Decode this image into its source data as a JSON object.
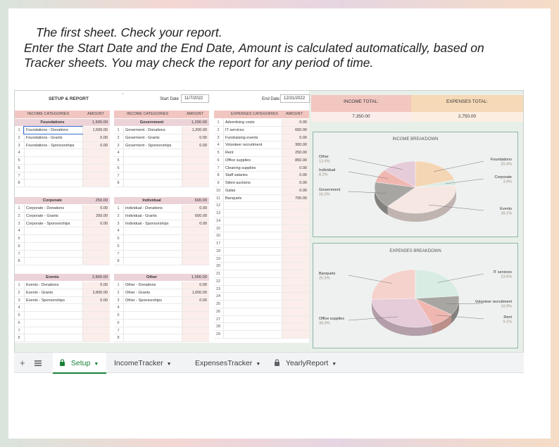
{
  "intro": {
    "line1": "The first sheet. Check your report.",
    "line2": "Enter the Start Date and the End Date, Amount is calculated automatically, based on",
    "line3": "Tracker sheets. You may check the report for any period of time."
  },
  "sheet": {
    "title": "SETUP & REPORT",
    "start_label": "Start Date",
    "start_value": "11/7/2022",
    "end_label": "End Date",
    "end_value": "12/31/2022",
    "income_header": {
      "cat": "INCOME CATEGORIES",
      "amt": "AMOUNT"
    },
    "expenses_header": {
      "cat": "EXPENSES CATEGORIES",
      "amt": "AMOUNT"
    },
    "income_blocks": [
      {
        "name": "Foundations",
        "total": "1,500.00",
        "items": [
          {
            "n": "1",
            "label": "Foundations - Donations",
            "amt": "1,500.00"
          },
          {
            "n": "2",
            "label": "Foundations - Grants",
            "amt": "0.00"
          },
          {
            "n": "3",
            "label": "Foundations - Sponsorships",
            "amt": "0.00"
          },
          {
            "n": "4",
            "label": "",
            "amt": ""
          },
          {
            "n": "5",
            "label": "",
            "amt": ""
          },
          {
            "n": "6",
            "label": "",
            "amt": ""
          },
          {
            "n": "7",
            "label": "",
            "amt": ""
          },
          {
            "n": "8",
            "label": "",
            "amt": ""
          }
        ]
      },
      {
        "name": "Government",
        "total": "1,200.00",
        "items": [
          {
            "n": "1",
            "label": "Goverment - Donations",
            "amt": "1,200.00"
          },
          {
            "n": "2",
            "label": "Goverment - Grants",
            "amt": "0.00"
          },
          {
            "n": "3",
            "label": "Goverment - Sponsorships",
            "amt": "0.00"
          },
          {
            "n": "4",
            "label": "",
            "amt": ""
          },
          {
            "n": "5",
            "label": "",
            "amt": ""
          },
          {
            "n": "6",
            "label": "",
            "amt": ""
          },
          {
            "n": "7",
            "label": "",
            "amt": ""
          },
          {
            "n": "8",
            "label": "",
            "amt": ""
          }
        ]
      },
      {
        "name": "Corporate",
        "total": "250.00",
        "items": [
          {
            "n": "1",
            "label": "Corporate - Donations",
            "amt": "0.00"
          },
          {
            "n": "2",
            "label": "Corporate - Grants",
            "amt": "250.00"
          },
          {
            "n": "3",
            "label": "Corporate - Sponsorships",
            "amt": "0.00"
          },
          {
            "n": "4",
            "label": "",
            "amt": ""
          },
          {
            "n": "5",
            "label": "",
            "amt": ""
          },
          {
            "n": "6",
            "label": "",
            "amt": ""
          },
          {
            "n": "7",
            "label": "",
            "amt": ""
          },
          {
            "n": "8",
            "label": "",
            "amt": ""
          }
        ]
      },
      {
        "name": "Individual",
        "total": "600.00",
        "items": [
          {
            "n": "1",
            "label": "Individual - Donations",
            "amt": "0.00"
          },
          {
            "n": "2",
            "label": "Individual - Grants",
            "amt": "600.00"
          },
          {
            "n": "3",
            "label": "Individual - Sponsorships",
            "amt": "0.00"
          },
          {
            "n": "4",
            "label": "",
            "amt": ""
          },
          {
            "n": "5",
            "label": "",
            "amt": ""
          },
          {
            "n": "6",
            "label": "",
            "amt": ""
          },
          {
            "n": "7",
            "label": "",
            "amt": ""
          },
          {
            "n": "8",
            "label": "",
            "amt": ""
          }
        ]
      },
      {
        "name": "Events",
        "total": "2,800.00",
        "items": [
          {
            "n": "1",
            "label": "Events - Donations",
            "amt": "0.00"
          },
          {
            "n": "2",
            "label": "Events - Grants",
            "amt": "2,800.00"
          },
          {
            "n": "3",
            "label": "Events - Sponsorships",
            "amt": "0.00"
          },
          {
            "n": "4",
            "label": "",
            "amt": ""
          },
          {
            "n": "5",
            "label": "",
            "amt": ""
          },
          {
            "n": "6",
            "label": "",
            "amt": ""
          },
          {
            "n": "7",
            "label": "",
            "amt": ""
          },
          {
            "n": "8",
            "label": "",
            "amt": ""
          }
        ]
      },
      {
        "name": "Other",
        "total": "1,000.00",
        "items": [
          {
            "n": "1",
            "label": "Other - Donations",
            "amt": "0.00"
          },
          {
            "n": "2",
            "label": "Other - Grants",
            "amt": "1,000.00"
          },
          {
            "n": "3",
            "label": "Other - Sponsorships",
            "amt": "0.00"
          },
          {
            "n": "4",
            "label": "",
            "amt": ""
          },
          {
            "n": "5",
            "label": "",
            "amt": ""
          },
          {
            "n": "6",
            "label": "",
            "amt": ""
          },
          {
            "n": "7",
            "label": "",
            "amt": ""
          },
          {
            "n": "8",
            "label": "",
            "amt": ""
          }
        ]
      }
    ],
    "expenses": [
      {
        "n": "1",
        "label": "Advertising costs",
        "amt": "0.00"
      },
      {
        "n": "2",
        "label": "IT services",
        "amt": "650.00"
      },
      {
        "n": "3",
        "label": "Fundraising events",
        "amt": "0.00"
      },
      {
        "n": "4",
        "label": "Volunteer recruitment",
        "amt": "300.00"
      },
      {
        "n": "5",
        "label": "Rent",
        "amt": "250.00"
      },
      {
        "n": "6",
        "label": "Office supplies",
        "amt": "850.00"
      },
      {
        "n": "7",
        "label": "Cleaning supplies",
        "amt": "0.00"
      },
      {
        "n": "8",
        "label": "Staff salaries",
        "amt": "0.00"
      },
      {
        "n": "9",
        "label": "Silent auctions",
        "amt": "0.00"
      },
      {
        "n": "10",
        "label": "Galas",
        "amt": "0.00"
      },
      {
        "n": "11",
        "label": "Banquets",
        "amt": "700.00"
      },
      {
        "n": "12",
        "label": "",
        "amt": ""
      },
      {
        "n": "13",
        "label": "",
        "amt": ""
      },
      {
        "n": "14",
        "label": "",
        "amt": ""
      },
      {
        "n": "15",
        "label": "",
        "amt": ""
      },
      {
        "n": "16",
        "label": "",
        "amt": ""
      },
      {
        "n": "17",
        "label": "",
        "amt": ""
      },
      {
        "n": "18",
        "label": "",
        "amt": ""
      },
      {
        "n": "19",
        "label": "",
        "amt": ""
      },
      {
        "n": "20",
        "label": "",
        "amt": ""
      },
      {
        "n": "21",
        "label": "",
        "amt": ""
      },
      {
        "n": "22",
        "label": "",
        "amt": ""
      },
      {
        "n": "23",
        "label": "",
        "amt": ""
      },
      {
        "n": "24",
        "label": "",
        "amt": ""
      },
      {
        "n": "25",
        "label": "",
        "amt": ""
      },
      {
        "n": "26",
        "label": "",
        "amt": ""
      },
      {
        "n": "27",
        "label": "",
        "amt": ""
      },
      {
        "n": "28",
        "label": "",
        "amt": ""
      },
      {
        "n": "29",
        "label": "",
        "amt": ""
      }
    ],
    "income_total_label": "INCOME TOTAL:",
    "income_total_value": "7,350.00",
    "expenses_total_label": "EXPENSES TOTAL:",
    "expenses_total_value": "2,750.00",
    "colors": {
      "income_total_bg": "#f2c7c0",
      "expenses_total_bg": "#f6d9b7",
      "header_bg": "#f1c6c0",
      "block_head_bg": "#ecd3d8"
    }
  },
  "income_chart": {
    "title": "INCOME BREAKDOWN",
    "slices": [
      {
        "name": "Foundations",
        "pct": "20.4%",
        "value": 20.4,
        "color": "#f5d6b4"
      },
      {
        "name": "Corporate",
        "pct": "3.4%",
        "value": 3.4,
        "color": "#d9ece4"
      },
      {
        "name": "Events",
        "pct": "38.1%",
        "value": 38.1,
        "color": "#f6e7e3"
      },
      {
        "name": "Government",
        "pct": "16.3%",
        "value": 16.3,
        "color": "#a8a6a2"
      },
      {
        "name": "Individual",
        "pct": "8.2%",
        "value": 8.2,
        "color": "#f0b7b1"
      },
      {
        "name": "Other",
        "pct": "13.6%",
        "value": 13.6,
        "color": "#e6cbd9"
      }
    ]
  },
  "expenses_chart": {
    "title": "EXPENSES BREAKDOWN",
    "slices": [
      {
        "name": "IT services",
        "pct": "23.6%",
        "value": 23.6,
        "color": "#d9ece4"
      },
      {
        "name": "Volunteer recruitment",
        "pct": "10.9%",
        "value": 10.9,
        "color": "#a8a6a2"
      },
      {
        "name": "Rent",
        "pct": "9.1%",
        "value": 9.1,
        "color": "#f0b7b1"
      },
      {
        "name": "Office supplies",
        "pct": "30.9%",
        "value": 30.9,
        "color": "#e6cbd9"
      },
      {
        "name": "Banquets",
        "pct": "25.5%",
        "value": 25.5,
        "color": "#f6d2cc"
      }
    ]
  },
  "tabs": {
    "add_icon": "plus-icon",
    "menu_icon": "list-icon",
    "items": [
      {
        "label": "Setup",
        "locked": true,
        "active": true
      },
      {
        "label": "IncomeTracker",
        "locked": false,
        "active": false
      },
      {
        "label": "ExpensesTracker",
        "locked": false,
        "active": false
      },
      {
        "label": "YearlyReport",
        "locked": true,
        "active": false
      }
    ]
  }
}
